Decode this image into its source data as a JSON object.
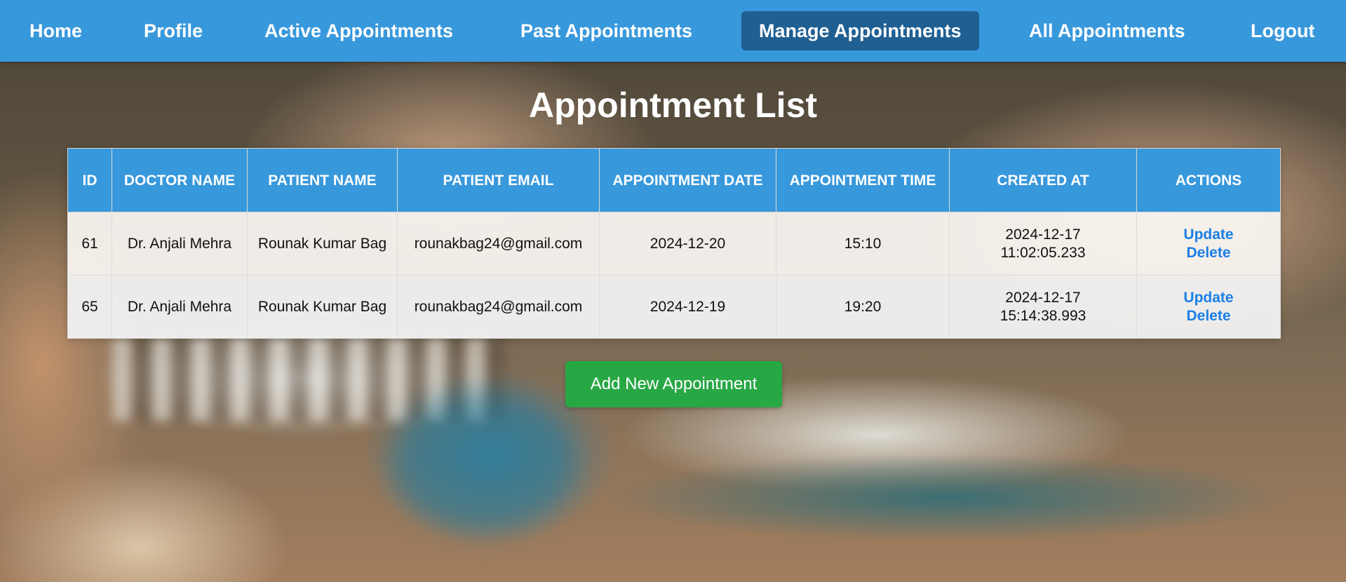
{
  "nav": {
    "items": [
      {
        "label": "Home"
      },
      {
        "label": "Profile"
      },
      {
        "label": "Active Appointments"
      },
      {
        "label": "Past Appointments"
      },
      {
        "label": "Manage Appointments",
        "active": true
      },
      {
        "label": "All Appointments"
      },
      {
        "label": "Logout"
      }
    ]
  },
  "page": {
    "title": "Appointment List"
  },
  "table": {
    "headers": {
      "id": "ID",
      "doctor": "DOCTOR NAME",
      "patient": "PATIENT NAME",
      "email": "PATIENT EMAIL",
      "date": "APPOINTMENT DATE",
      "time": "APPOINTMENT TIME",
      "created": "CREATED AT",
      "actions": "ACTIONS"
    },
    "rows": [
      {
        "id": "61",
        "doctor": "Dr. Anjali Mehra",
        "patient": "Rounak Kumar Bag",
        "email": "rounakbag24@gmail.com",
        "date": "2024-12-20",
        "time": "15:10",
        "created_date": "2024-12-17",
        "created_time": "11:02:05.233",
        "update_label": "Update",
        "delete_label": "Delete"
      },
      {
        "id": "65",
        "doctor": "Dr. Anjali Mehra",
        "patient": "Rounak Kumar Bag",
        "email": "rounakbag24@gmail.com",
        "date": "2024-12-19",
        "time": "19:20",
        "created_date": "2024-12-17",
        "created_time": "15:14:38.993",
        "update_label": "Update",
        "delete_label": "Delete"
      }
    ]
  },
  "actions": {
    "add_label": "Add New Appointment"
  },
  "colors": {
    "nav_bg": "#3898dc",
    "nav_active": "#1f5f92",
    "link": "#1a7fe6",
    "add_button": "#28a745"
  }
}
